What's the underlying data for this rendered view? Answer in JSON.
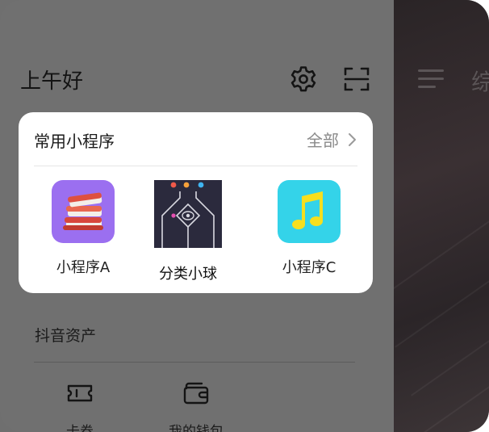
{
  "header": {
    "greeting": "上午好",
    "settings_icon": "gear-icon",
    "scan_icon": "scan-icon"
  },
  "mini_programs": {
    "title": "常用小程序",
    "all_label": "全部",
    "items": [
      {
        "label": "小程序A",
        "icon": "books-icon",
        "color": "#9b6ff0"
      },
      {
        "label": "分类小球",
        "icon": "ball-game-icon",
        "color": "#2b2a3d"
      },
      {
        "label": "小程序C",
        "icon": "music-note-icon",
        "color": "#34d3e9"
      }
    ]
  },
  "assets": {
    "title": "抖音资产",
    "items": [
      {
        "label": "卡券",
        "icon": "ticket-icon"
      },
      {
        "label": "我的钱包",
        "icon": "wallet-icon"
      }
    ]
  },
  "backdrop": {
    "partial_text": "综"
  }
}
